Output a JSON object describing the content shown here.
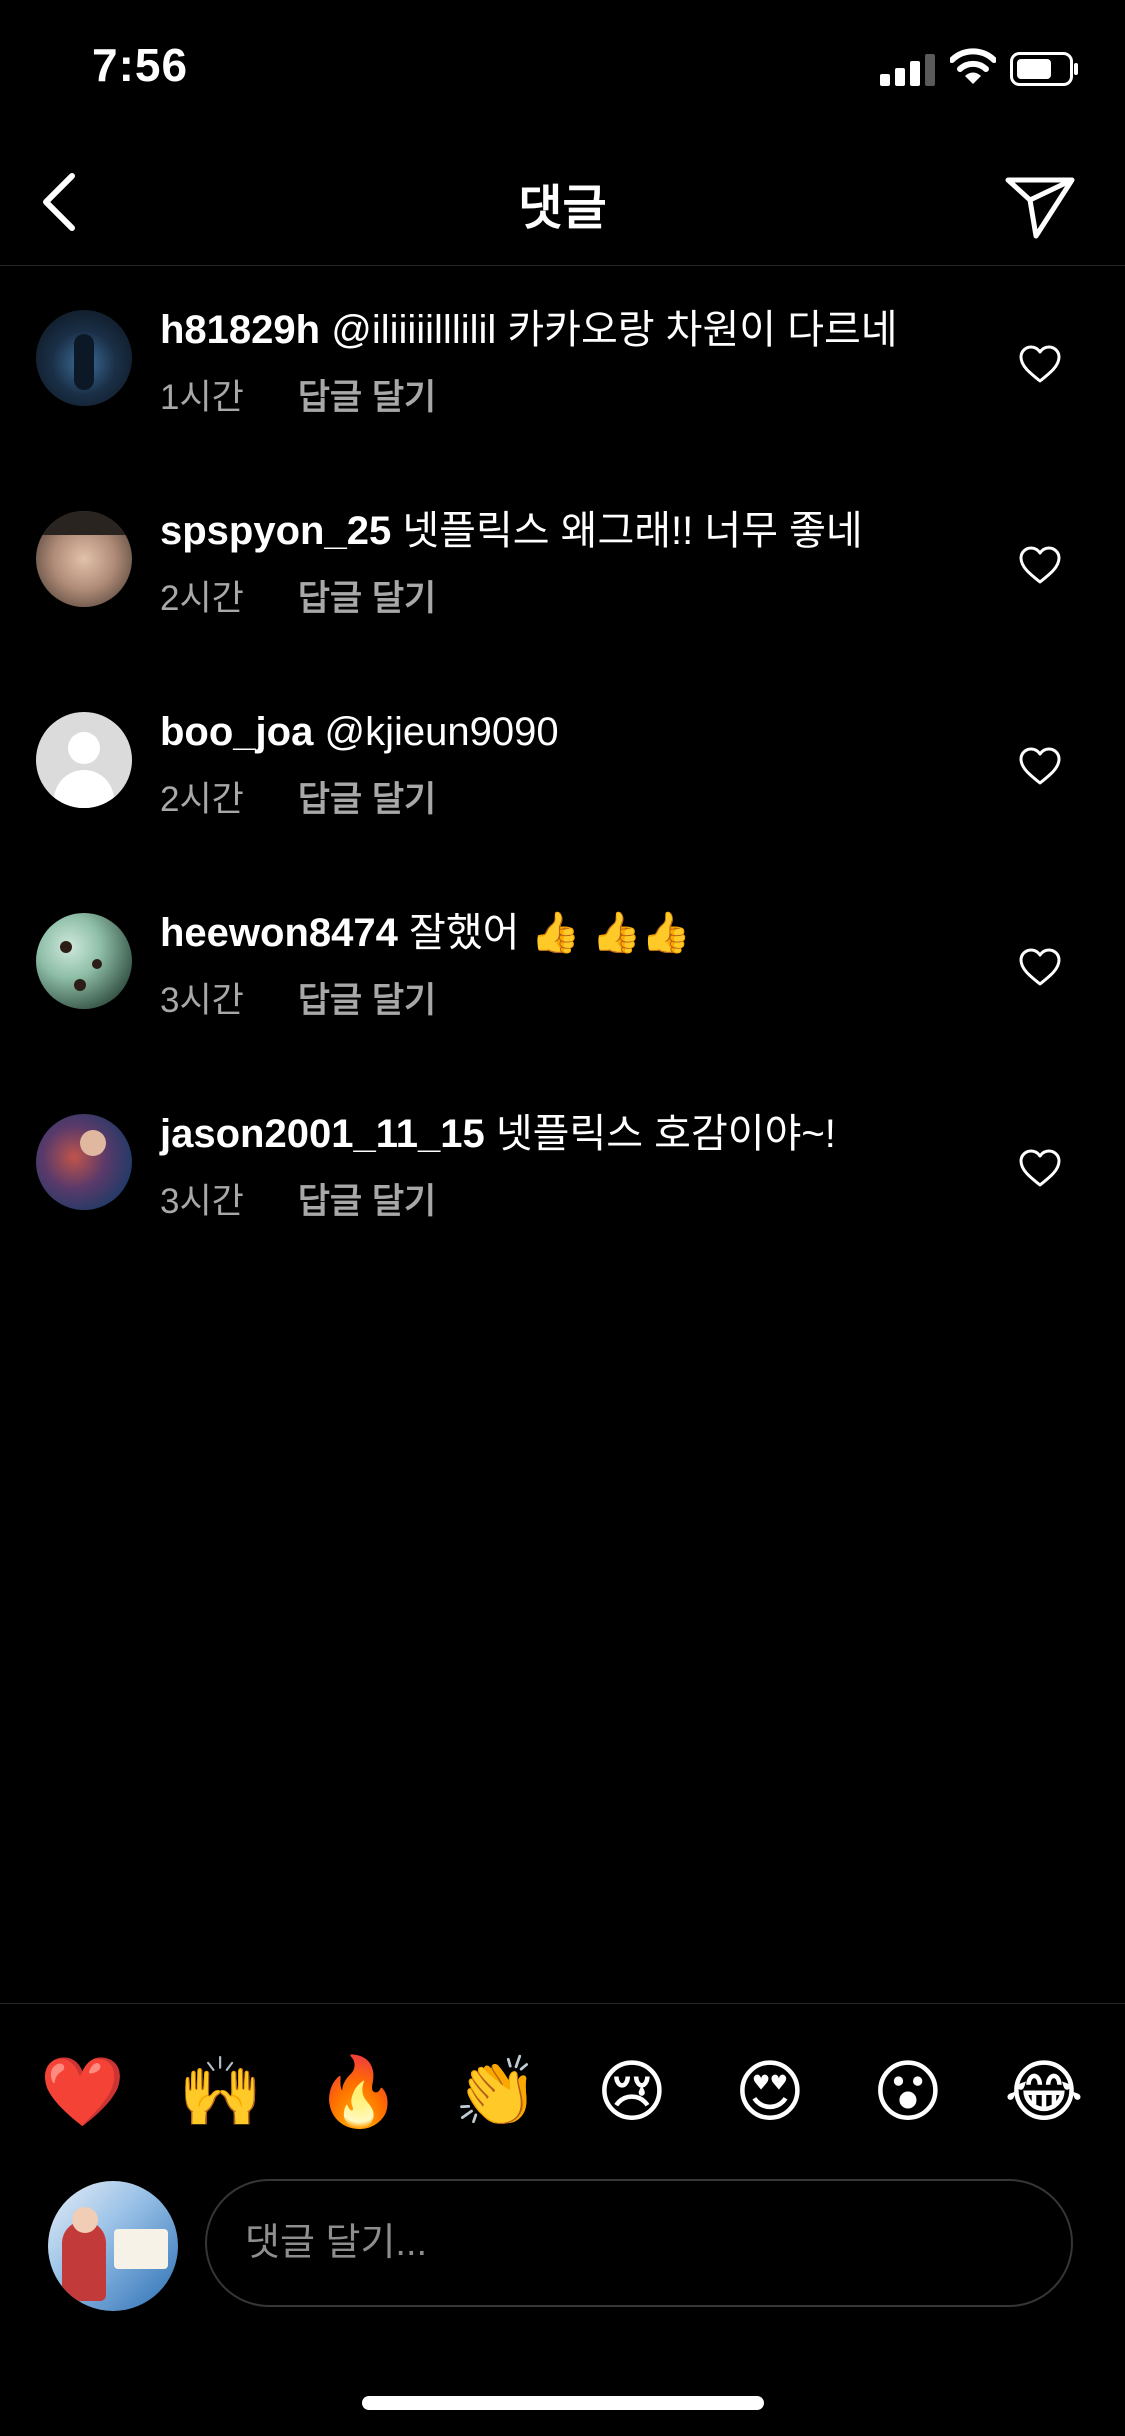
{
  "status_bar": {
    "time": "7:56"
  },
  "header": {
    "title": "댓글"
  },
  "comments": [
    {
      "username": "h81829h",
      "text": "@iliiiiilllilil 카카오랑 차원이 다르네",
      "time": "1시간",
      "reply_label": "답글 달기"
    },
    {
      "username": "spspyon_25",
      "text": "넷플릭스 왜그래!! 너무 좋네",
      "time": "2시간",
      "reply_label": "답글 달기"
    },
    {
      "username": "boo_joa",
      "text": "@kjieun9090",
      "time": "2시간",
      "reply_label": "답글 달기"
    },
    {
      "username": "heewon8474",
      "text": "잘했어 👍 👍👍",
      "time": "3시간",
      "reply_label": "답글 달기"
    },
    {
      "username": "jason2001_11_15",
      "text": "넷플릭스 호감이야~!",
      "time": "3시간",
      "reply_label": "답글 달기"
    }
  ],
  "reactions": [
    "❤️",
    "🙌",
    "🔥",
    "👏",
    "😢",
    "😍",
    "😮",
    "😂"
  ],
  "composer": {
    "placeholder": "댓글 달기..."
  }
}
